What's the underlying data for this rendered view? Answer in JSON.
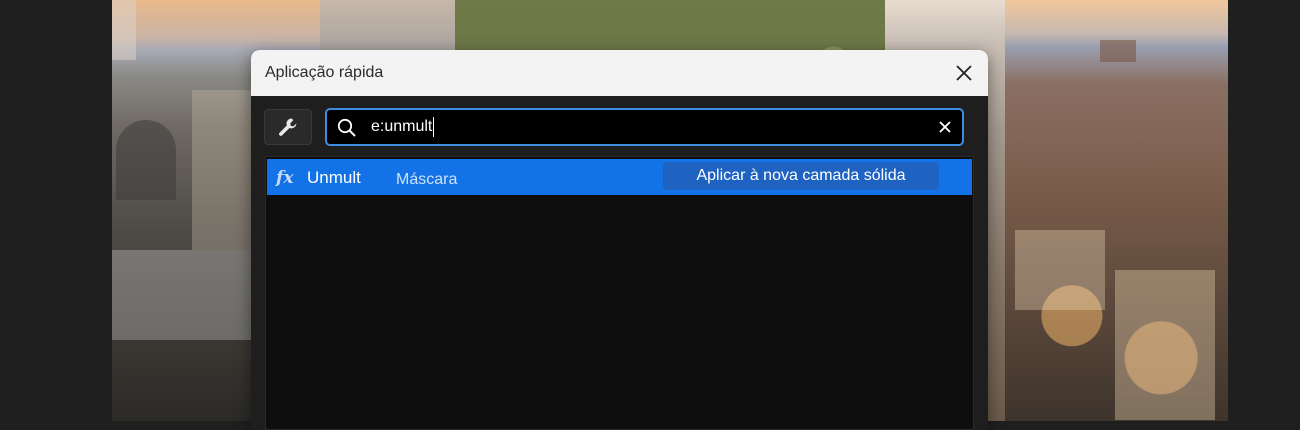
{
  "dialog": {
    "title": "Aplicação rápida",
    "close_icon": "close-icon",
    "tool_icon": "wrench-icon"
  },
  "search": {
    "icon": "search-icon",
    "value": "e:unmult",
    "clear_icon": "clear-icon"
  },
  "results": [
    {
      "icon": "fx-icon",
      "icon_text": "fx",
      "name": "Unmult",
      "category": "Máscara",
      "action_label": "Aplicar à nova camada sólida",
      "selected": true
    }
  ],
  "colors": {
    "accent": "#1373e6",
    "search_border": "#3f8de0",
    "titlebar": "#f3f3f3",
    "panel": "#1e1e1e"
  }
}
